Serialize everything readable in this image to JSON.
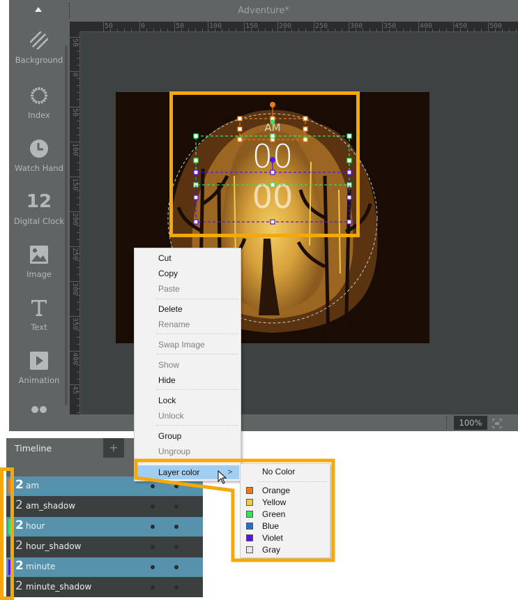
{
  "window": {
    "title": "Adventure*"
  },
  "toolbar": {
    "items": [
      {
        "label": "Background",
        "icon": "background-icon"
      },
      {
        "label": "Index",
        "icon": "index-icon"
      },
      {
        "label": "Watch Hand",
        "icon": "watch-hand-icon"
      },
      {
        "label": "Digital Clock",
        "icon": "digital-clock-icon",
        "glyph": "12"
      },
      {
        "label": "Image",
        "icon": "image-icon"
      },
      {
        "label": "Text",
        "icon": "text-icon",
        "glyph": "T"
      },
      {
        "label": "Animation",
        "icon": "animation-icon"
      }
    ]
  },
  "rulers": {
    "top_labels": [
      "50",
      "0",
      "50",
      "100",
      "150",
      "200",
      "250",
      "300",
      "350",
      "400",
      "450",
      "500"
    ],
    "left_labels": [
      "50",
      "0",
      "50",
      "100",
      "150",
      "200",
      "250",
      "300",
      "350",
      "400",
      "45"
    ]
  },
  "canvas": {
    "widgets": {
      "am_text": "AM",
      "hour_text": "00",
      "minute_text": "00"
    },
    "selection_colors": {
      "am": "#f07a12",
      "hour": "#36e25a",
      "minute": "#5511f0"
    }
  },
  "statusbar": {
    "zoom": "100%"
  },
  "timeline": {
    "title": "Timeline",
    "add_label": "+",
    "layers": [
      {
        "icon": "2",
        "name": "am",
        "selected": true,
        "color": "#f07a12"
      },
      {
        "icon": "2",
        "name": "am_shadow",
        "selected": false,
        "color": ""
      },
      {
        "icon": "2",
        "name": "hour",
        "selected": true,
        "color": "#36e25a"
      },
      {
        "icon": "2",
        "name": "hour_shadow",
        "selected": false,
        "color": ""
      },
      {
        "icon": "2",
        "name": "minute",
        "selected": true,
        "color": "#5511f0"
      },
      {
        "icon": "2",
        "name": "minute_shadow",
        "selected": false,
        "color": ""
      }
    ]
  },
  "context_menu": {
    "items": [
      {
        "label": "Cut",
        "enabled": true
      },
      {
        "label": "Copy",
        "enabled": true
      },
      {
        "label": "Paste",
        "enabled": false
      },
      {
        "label": "Delete",
        "enabled": true
      },
      {
        "label": "Rename",
        "enabled": false
      },
      {
        "label": "Swap Image",
        "enabled": false
      },
      {
        "label": "Show",
        "enabled": false
      },
      {
        "label": "Hide",
        "enabled": true
      },
      {
        "label": "Lock",
        "enabled": true
      },
      {
        "label": "Unlock",
        "enabled": false
      },
      {
        "label": "Group",
        "enabled": true
      },
      {
        "label": "Ungroup",
        "enabled": false
      },
      {
        "label": "Layer color",
        "enabled": true,
        "highlighted": true,
        "submenu_arrow": ">"
      }
    ]
  },
  "layer_color_submenu": {
    "no_color": "No Color",
    "colors": [
      {
        "label": "Orange",
        "hex": "#f07a12"
      },
      {
        "label": "Yellow",
        "hex": "#f2c94a"
      },
      {
        "label": "Green",
        "hex": "#36e25a"
      },
      {
        "label": "Blue",
        "hex": "#1f73d6"
      },
      {
        "label": "Violet",
        "hex": "#5511f0"
      },
      {
        "label": "Gray",
        "hex": "#e6e6e6"
      }
    ]
  },
  "accent": {
    "highlight_outline": "#f5a80a"
  }
}
